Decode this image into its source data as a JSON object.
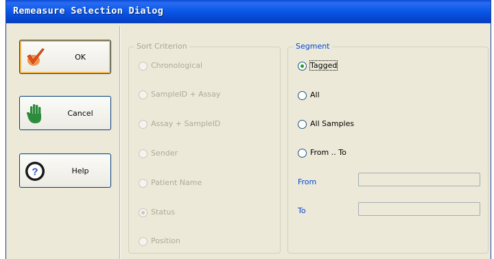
{
  "window": {
    "title": "Remeasure Selection Dialog"
  },
  "buttons": {
    "ok": "OK",
    "cancel": "Cancel",
    "help": "Help"
  },
  "sort_criterion": {
    "legend": "Sort Criterion",
    "enabled": false,
    "selected": "Status",
    "options": [
      "Chronological",
      "SampleID + Assay",
      "Assay + SampleID",
      "Sender",
      "Patient Name",
      "Status",
      "Position"
    ]
  },
  "segment": {
    "legend": "Segment",
    "selected": "Tagged",
    "options": [
      "Tagged",
      "All",
      "All Samples",
      "From .. To"
    ],
    "from_label": "From",
    "from_value": "",
    "to_label": "To",
    "to_value": ""
  },
  "colors": {
    "title_bar": "#0a5ae8",
    "dialog_bg": "#ece9d8",
    "group_label_blue": "#0046d5",
    "disabled_text": "#acaa9c",
    "radio_selected": "#21a121"
  }
}
